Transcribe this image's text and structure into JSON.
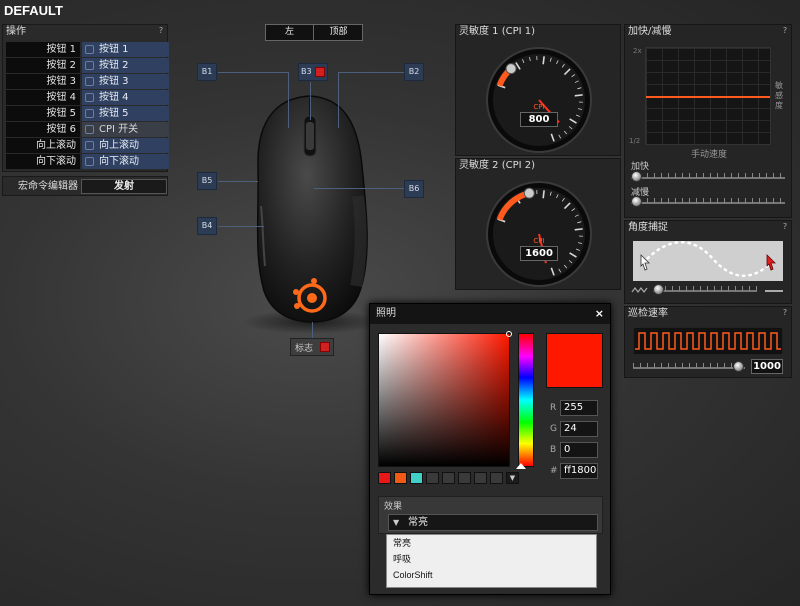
{
  "profile": {
    "name": "DEFAULT"
  },
  "actions": {
    "title": "操作",
    "rows": [
      {
        "label": "按钮 1",
        "value": "按钮 1"
      },
      {
        "label": "按钮 2",
        "value": "按钮 2"
      },
      {
        "label": "按钮 3",
        "value": "按钮 3"
      },
      {
        "label": "按钮 4",
        "value": "按钮 4"
      },
      {
        "label": "按钮 5",
        "value": "按钮 5"
      },
      {
        "label": "按钮 6",
        "value": "CPI 开关"
      },
      {
        "label": "向上滚动",
        "value": "向上滚动"
      },
      {
        "label": "向下滚动",
        "value": "向下滚动"
      }
    ],
    "macro_label": "宏命令编辑器",
    "macro_button": "发射"
  },
  "toggle": {
    "left": "左",
    "right": "顶部"
  },
  "mouse_tags": {
    "b1": "B1",
    "b2": "B2",
    "b3": "B3",
    "b4": "B4",
    "b5": "B5",
    "b6": "B6",
    "logo": "标志"
  },
  "cpi1": {
    "title": "灵敏度 1 (CPI 1)",
    "unit": "CPI",
    "value": 800,
    "max": 6500
  },
  "cpi2": {
    "title": "灵敏度 2 (CPI 2)",
    "unit": "CPI",
    "value": 1600,
    "max": 6500
  },
  "accel": {
    "title": "加快/减慢",
    "y_top": "2x",
    "y_bottom": "1/2",
    "x_label": "手动速度",
    "y_label": "敏感度",
    "accel_label": "加快",
    "decel_label": "减慢"
  },
  "angle": {
    "title": "角度捕捉"
  },
  "polling": {
    "title": "巡检速率",
    "value": "1000"
  },
  "lighting": {
    "title": "照明",
    "close": "×",
    "r": "255",
    "g": "24",
    "b": "0",
    "hex": "ff1800",
    "r_label": "R",
    "g_label": "G",
    "b_label": "B",
    "hex_label": "#",
    "swatches": [
      "#e81818",
      "#f05a14",
      "#40d0c8"
    ],
    "current_color": "#ff1800",
    "effect_label": "效果",
    "effect_selected": "常亮",
    "effect_options": [
      "常亮",
      "呼吸",
      "ColorShift"
    ]
  },
  "colors": {
    "accent": "#ff5a1e",
    "selected_row": "#2f4060"
  }
}
